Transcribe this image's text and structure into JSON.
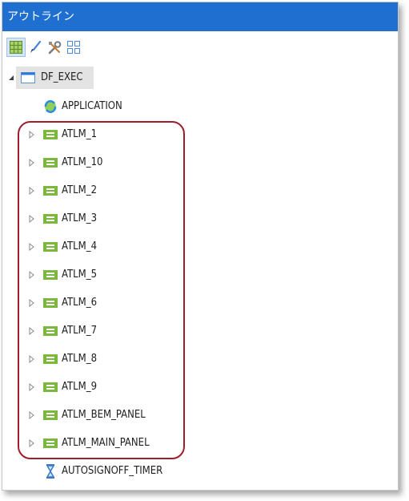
{
  "window": {
    "title": "アウトライン"
  },
  "toolbar": {
    "buttons": [
      {
        "name": "grid-view-button",
        "icon": "grid-icon",
        "active": true,
        "color": "#7ab43c"
      },
      {
        "name": "brush-button",
        "icon": "brush-icon",
        "active": false,
        "color": "#3f7fd4"
      },
      {
        "name": "tools-button",
        "icon": "tools-icon",
        "active": false,
        "color": "#808080"
      },
      {
        "name": "layout-button",
        "icon": "layout-grid-icon",
        "active": false,
        "color": "#4a8ad8"
      }
    ]
  },
  "tree": {
    "root": {
      "label": "DF_EXEC",
      "icon": "window-icon",
      "expanded": true,
      "selected": true
    },
    "children": [
      {
        "label": "APPLICATION",
        "icon": "application-icon",
        "expandable": false
      },
      {
        "label": "ATLM_1",
        "icon": "panel-icon",
        "expandable": true
      },
      {
        "label": "ATLM_10",
        "icon": "panel-icon",
        "expandable": true
      },
      {
        "label": "ATLM_2",
        "icon": "panel-icon",
        "expandable": true
      },
      {
        "label": "ATLM_3",
        "icon": "panel-icon",
        "expandable": true
      },
      {
        "label": "ATLM_4",
        "icon": "panel-icon",
        "expandable": true
      },
      {
        "label": "ATLM_5",
        "icon": "panel-icon",
        "expandable": true
      },
      {
        "label": "ATLM_6",
        "icon": "panel-icon",
        "expandable": true
      },
      {
        "label": "ATLM_7",
        "icon": "panel-icon",
        "expandable": true
      },
      {
        "label": "ATLM_8",
        "icon": "panel-icon",
        "expandable": true
      },
      {
        "label": "ATLM_9",
        "icon": "panel-icon",
        "expandable": true
      },
      {
        "label": "ATLM_BEM_PANEL",
        "icon": "panel-icon",
        "expandable": true
      },
      {
        "label": "ATLM_MAIN_PANEL",
        "icon": "panel-icon",
        "expandable": true
      },
      {
        "label": "AUTOSIGNOFF_TIMER",
        "icon": "hourglass-icon",
        "expandable": false
      }
    ]
  },
  "colors": {
    "title_bar": "#1f6fd1",
    "panel_icon": "#7cb83e",
    "highlight": "#a01c2c",
    "hourglass": "#3a78c8"
  }
}
